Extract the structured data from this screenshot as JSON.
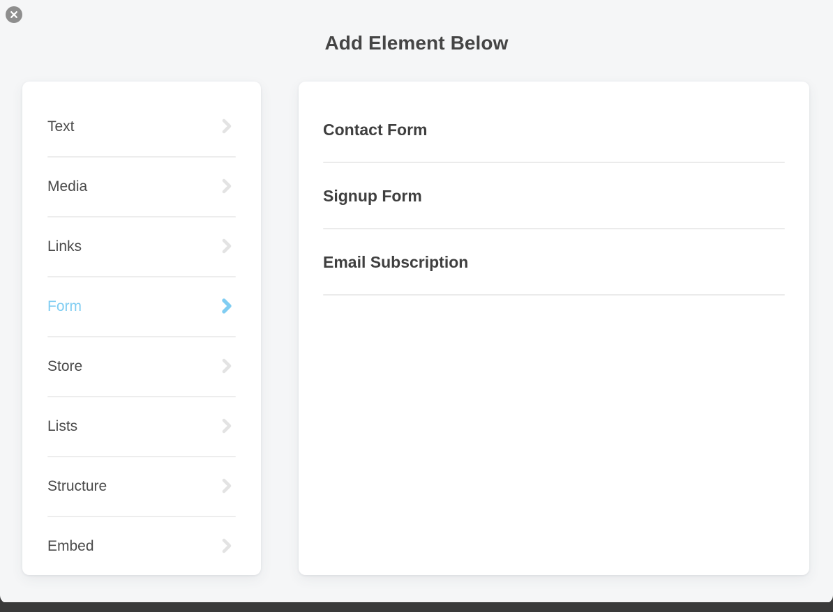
{
  "window": {
    "title": "Add Element Below",
    "background_color": "#f5f6f7",
    "accent_color": "#80cdf2"
  },
  "close_button": {
    "name": "close",
    "icon": "close-x-icon",
    "circle_color": "#8e8e8e",
    "glyph_color": "#ffffff"
  },
  "category_panel": {
    "items": [
      {
        "label": "Text",
        "icon": "chevron-right-icon",
        "active": false
      },
      {
        "label": "Media",
        "icon": "chevron-right-icon",
        "active": false
      },
      {
        "label": "Links",
        "icon": "chevron-right-icon",
        "active": false
      },
      {
        "label": "Form",
        "icon": "chevron-right-icon",
        "active": true
      },
      {
        "label": "Store",
        "icon": "chevron-right-icon",
        "active": false
      },
      {
        "label": "Lists",
        "icon": "chevron-right-icon",
        "active": false
      },
      {
        "label": "Structure",
        "icon": "chevron-right-icon",
        "active": false
      },
      {
        "label": "Embed",
        "icon": "chevron-right-icon",
        "active": false
      }
    ]
  },
  "options_panel": {
    "items": [
      {
        "label": "Contact Form"
      },
      {
        "label": "Signup Form"
      },
      {
        "label": "Email Subscription"
      }
    ]
  }
}
